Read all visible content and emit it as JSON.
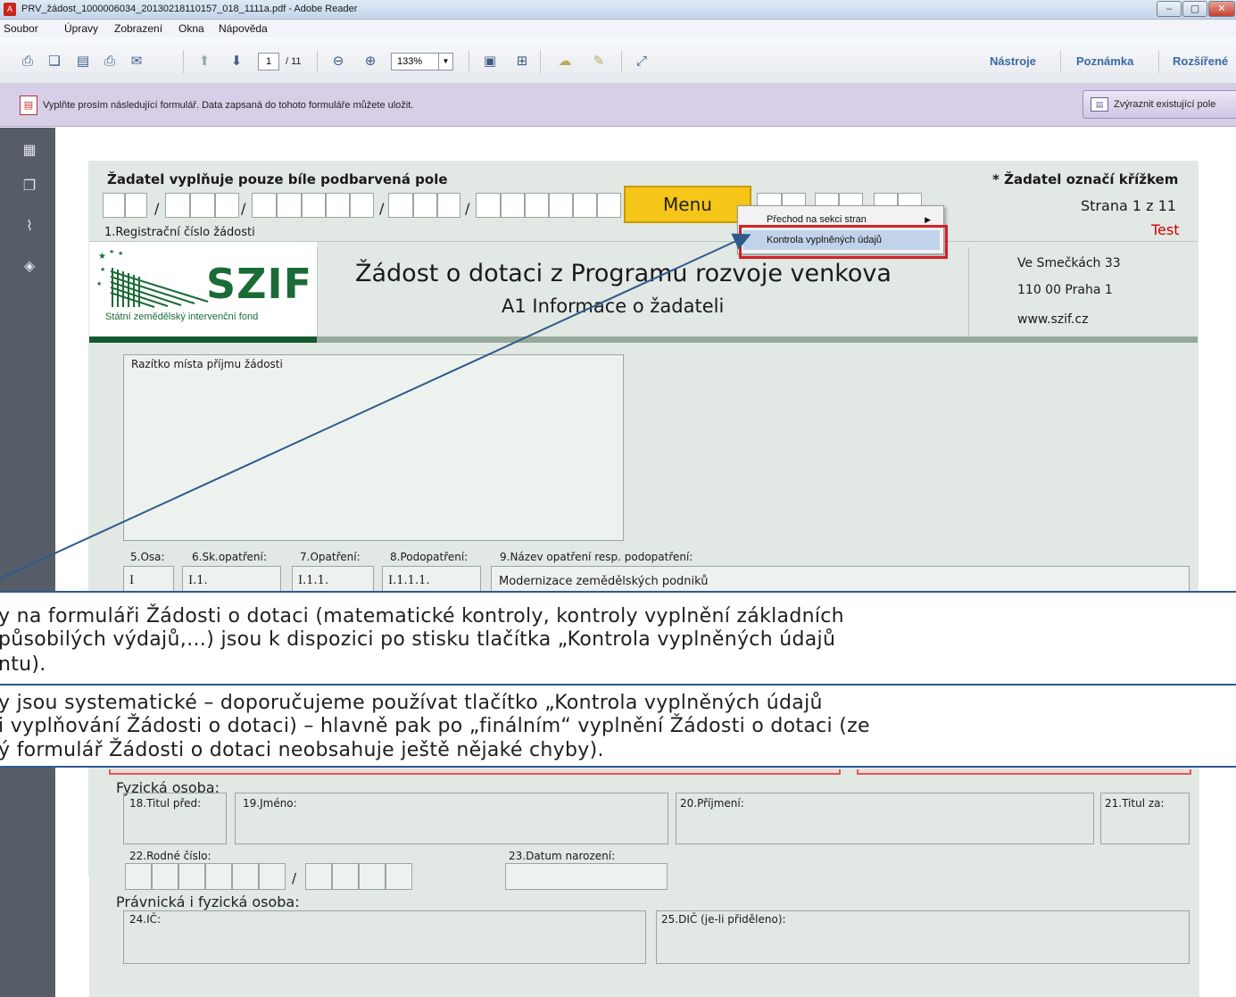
{
  "window": {
    "title": "PRV_žádost_1000006034_20130218110157_018_1111a.pdf - Adobe Reader",
    "minimize": "–",
    "maximize": "▢",
    "close": "✕"
  },
  "menubar": [
    "Soubor",
    "Úpravy",
    "Zobrazení",
    "Okna",
    "Nápověda"
  ],
  "toolbar": {
    "page_current": "1",
    "page_total": "/ 11",
    "zoom": "133%",
    "links": [
      "Nástroje",
      "Poznámka",
      "Rozšířené"
    ]
  },
  "formbar": {
    "message": "Vyplňte prosím následující formulář. Data zapsaná do tohoto formuláře můžete uložit.",
    "highlight_button": "Zvýraznit existující pole"
  },
  "form": {
    "header_left": "Žadatel vyplňuje pouze bíle podbarvená pole",
    "header_right": "* Žadatel označí křížkem",
    "page_info": "Strana 1 z 11",
    "test_label": "Test",
    "reg_label": "1.Registrační číslo žádosti",
    "menu_button": "Menu",
    "menu_items": [
      "Přechod na sekci stran",
      "Kontrola vyplněných údajů"
    ],
    "logo_text": "SZIF",
    "logo_subtitle": "Státní zemědělský intervenční fond",
    "doc_title": "Žádost o dotaci z Programu rozvoje venkova",
    "doc_subtitle": "A1 Informace o žadateli",
    "address": [
      "Ve Smečkách 33",
      "110 00 Praha 1",
      "www.szif.cz"
    ],
    "stamp_label": "Razítko místa příjmu žádosti",
    "fields_row": [
      {
        "label": "5.Osa:",
        "value": "I"
      },
      {
        "label": "6.Sk.opatření:",
        "value": "I.1."
      },
      {
        "label": "7.Opatření:",
        "value": "I.1.1."
      },
      {
        "label": "8.Podopatření:",
        "value": "I.1.1.1."
      },
      {
        "label": "9.Název opatření resp. podopatření:",
        "value": "Modernizace zemědělských podniků"
      }
    ]
  },
  "overlay_text": [
    "y na formuláři Žádosti o dotaci (matematické kontroly, kontroly vyplnění základních",
    "působilých výdajů,…) jsou k dispozici po stisku tlačítka „Kontrola vyplněných údajů",
    "ntu).",
    "y jsou systematické – doporučujeme používat tlačítko „Kontrola vyplněných údajů",
    "i vyplňování Žádosti o dotaci) – hlavně pak po „finálním“ vyplnění Žádosti o dotaci (ze",
    "ý formulář Žádosti o dotaci neobsahuje ještě nějaké chyby)."
  ],
  "lower_form": {
    "section_person": "Fyzická osoba:",
    "title_before": "18.Titul před:",
    "first_name": "19.Jméno:",
    "surname": "20.Příjmení:",
    "title_after": "21.Titul za:",
    "birth_number": "22.Rodné číslo:",
    "birth_date": "23.Datum narození:",
    "section_both": "Právnická i fyzická osoba:",
    "ico": "24.IČ:",
    "dic": "25.DIČ (je-li přiděleno):"
  },
  "colors": {
    "accent": "#2e5a8c",
    "szif_green": "#1b6b37",
    "menu_yellow": "#f5c518",
    "highlight_red": "#d41f26",
    "test_red": "#d00000"
  }
}
